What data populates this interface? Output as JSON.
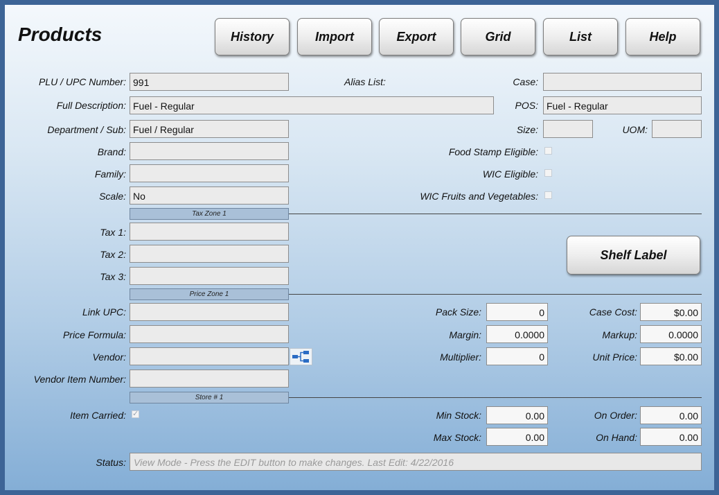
{
  "window": {
    "title": "Products"
  },
  "toolbar": {
    "history": "History",
    "import": "Import",
    "export": "Export",
    "grid": "Grid",
    "list": "List",
    "help": "Help"
  },
  "fields": {
    "plu_label": "PLU / UPC Number:",
    "plu_value": "991",
    "alias_label": "Alias List:",
    "case_label": "Case:",
    "case_value": "",
    "desc_label": "Full Description:",
    "desc_value": "Fuel - Regular",
    "pos_label": "POS:",
    "pos_value": "Fuel - Regular",
    "dept_label": "Department / Sub:",
    "dept_value": "Fuel / Regular",
    "size_label": "Size:",
    "size_value": "",
    "uom_label": "UOM:",
    "uom_value": "",
    "brand_label": "Brand:",
    "brand_value": "",
    "family_label": "Family:",
    "family_value": "",
    "scale_label": "Scale:",
    "scale_value": "No",
    "food_stamp_label": "Food Stamp Eligible:",
    "wic_label": "WIC Eligible:",
    "wic_fv_label": "WIC Fruits and Vegetables:"
  },
  "tax_zone": {
    "header": "Tax Zone 1",
    "tax1_label": "Tax 1:",
    "tax1_value": "",
    "tax2_label": "Tax 2:",
    "tax2_value": "",
    "tax3_label": "Tax 3:",
    "tax3_value": ""
  },
  "shelf_label_button": "Shelf Label",
  "price_zone": {
    "header": "Price Zone 1",
    "link_upc_label": "Link UPC:",
    "link_upc_value": "",
    "price_formula_label": "Price Formula:",
    "price_formula_value": "",
    "vendor_label": "Vendor:",
    "vendor_value": "",
    "vendor_item_label": "Vendor Item Number:",
    "vendor_item_value": "",
    "pack_size_label": "Pack Size:",
    "pack_size_value": "0",
    "margin_label": "Margin:",
    "margin_value": "0.0000",
    "multiplier_label": "Multiplier:",
    "multiplier_value": "0",
    "case_cost_label": "Case Cost:",
    "case_cost_value": "$0.00",
    "markup_label": "Markup:",
    "markup_value": "0.0000",
    "unit_price_label": "Unit Price:",
    "unit_price_value": "$0.00"
  },
  "store": {
    "header": "Store # 1",
    "item_carried_label": "Item Carried:",
    "min_stock_label": "Min Stock:",
    "min_stock_value": "0.00",
    "max_stock_label": "Max Stock:",
    "max_stock_value": "0.00",
    "on_order_label": "On Order:",
    "on_order_value": "0.00",
    "on_hand_label": "On Hand:",
    "on_hand_value": "0.00"
  },
  "status": {
    "label": "Status:",
    "text": "View Mode - Press the EDIT button to make changes. Last Edit: 4/22/2016"
  },
  "checkboxes": {
    "food_stamp": false,
    "wic": false,
    "wic_fv": false,
    "item_carried": true
  },
  "icons": {
    "vendor_lookup": "vendor-lookup-icon"
  }
}
